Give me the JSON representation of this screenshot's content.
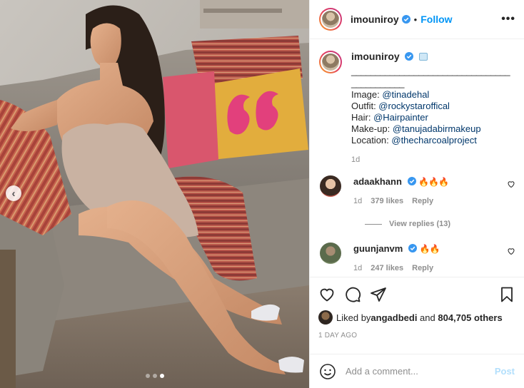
{
  "post": {
    "username": "imouniroy",
    "follow_label": "Follow",
    "separator": "•",
    "more_label": "•••"
  },
  "caption": {
    "username": "imouniroy",
    "underscores": "____________________________________________",
    "lines": [
      {
        "label": "Image: ",
        "mention": "@tinadehal"
      },
      {
        "label": "Outfit: ",
        "mention": "@rockystaroffical"
      },
      {
        "label": "Hair: ",
        "mention": "@Hairpainter"
      },
      {
        "label": "Make-up: ",
        "mention": "@tanujadabirmakeup"
      },
      {
        "label": "Location: ",
        "mention": "@thecharcoalproject"
      }
    ],
    "time": "1d"
  },
  "comments": [
    {
      "username": "adaakhann",
      "text": "🔥🔥🔥",
      "time": "1d",
      "likes": "379 likes",
      "reply": "Reply"
    },
    {
      "username": "guunjanvm",
      "text": "🔥🔥",
      "time": "1d",
      "likes": "247 likes",
      "reply": "Reply"
    }
  ],
  "view_replies": "View replies (13)",
  "likes": {
    "prefix": "Liked by ",
    "user": "angadbedi",
    "middle": " and ",
    "count": "804,705 others"
  },
  "timestamp": "1 DAY AGO",
  "add_comment": {
    "placeholder": "Add a comment...",
    "post_label": "Post"
  },
  "carousel": {
    "slide_count": 3,
    "active_index": 2,
    "prev_label": "‹"
  },
  "colors": {
    "link_blue": "#0095f6",
    "mention": "#00376b",
    "muted": "#8e8e8e",
    "verified": "#3897f0",
    "post_disabled": "#b2dffc"
  }
}
